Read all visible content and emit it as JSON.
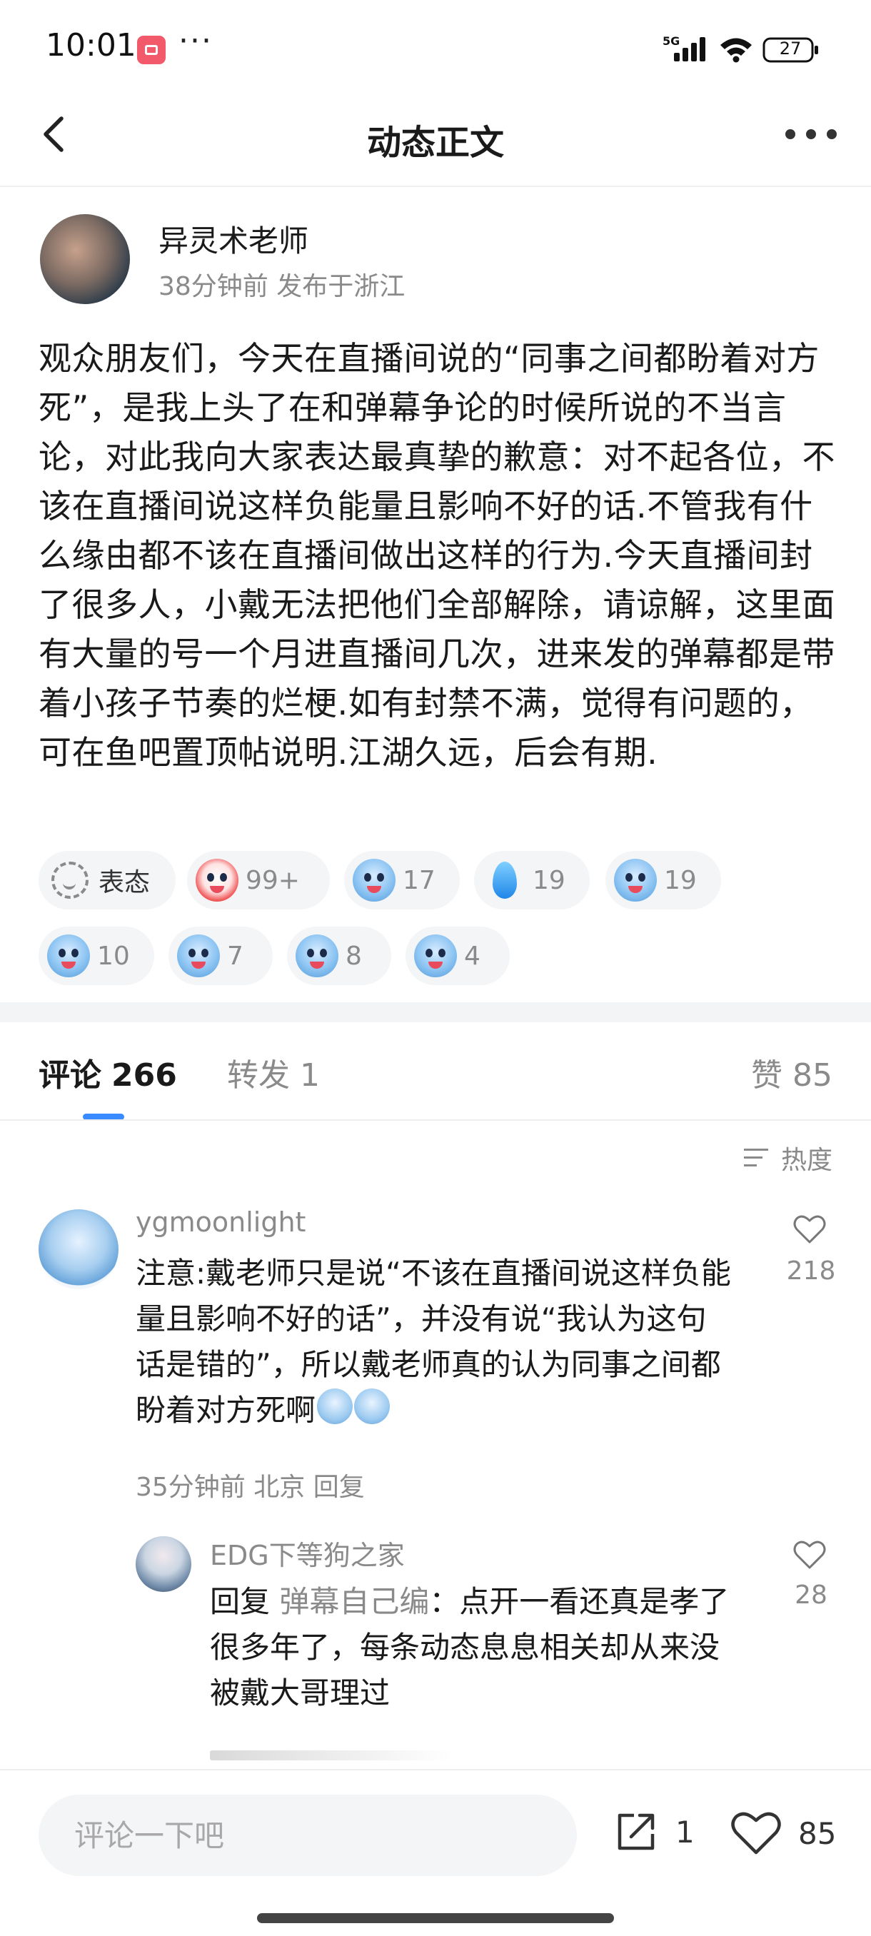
{
  "status_bar": {
    "time": "10:01",
    "more": "···",
    "network": "5G",
    "battery": "27"
  },
  "header": {
    "title": "动态正文"
  },
  "post": {
    "author": "异灵术老师",
    "meta": "38分钟前 发布于浙江",
    "body": "观众朋友们，今天在直播间说的“同事之间都盼着对方死”，是我上头了在和弹幕争论的时候所说的不当言论，对此我向大家表达最真挚的歉意：对不起各位，不该在直播间说这样负能量且影响不好的话.不管我有什么缘由都不该在直播间做出这样的行为.今天直播间封了很多人，小戴无法把他们全部解除，请谅解，这里面有大量的号一个月进直播间几次，进来发的弹幕都是带着小孩子节奏的烂梗.如有封禁不满，觉得有问题的，可在鱼吧置顶帖说明.江湖久远，后会有期."
  },
  "reactions": {
    "react_label": "表态",
    "items": [
      {
        "icon": "clown-emoji-icon",
        "count": "99+"
      },
      {
        "icon": "shark-surprised-emoji-icon",
        "count": "17"
      },
      {
        "icon": "water-drop-emoji-icon",
        "count": "19"
      },
      {
        "icon": "shark-sweat-emoji-icon",
        "count": "19"
      },
      {
        "icon": "shark-angry-emoji-icon",
        "count": "10"
      },
      {
        "icon": "shark-sign-emoji-icon",
        "count": "7"
      },
      {
        "icon": "shark-smirk-emoji-icon",
        "count": "8"
      },
      {
        "icon": "shark-starry-eyes-emoji-icon",
        "count": "4"
      }
    ]
  },
  "tabs": {
    "comments_label": "评论",
    "comments_count": "266",
    "reposts_label": "转发",
    "reposts_count": "1",
    "likes_label": "赞",
    "likes_count": "85"
  },
  "sort": {
    "label": "热度"
  },
  "comments": [
    {
      "user": "ygmoonlight",
      "text": "注意:戴老师只是说“不该在直播间说这样负能量且影响不好的话”，并没有说“我认为这句话是错的”，所以戴老师真的认为同事之间都盼着对方死啊",
      "meta": "35分钟前 北京 回复",
      "likes": "218"
    },
    {
      "user": "EDG下等狗之家",
      "reply_prefix": "回复",
      "reply_target": "弹幕自己编",
      "text": "：点开一看还真是孝了很多年了，每条动态息息相关却从来没被戴大哥理过",
      "likes": "28"
    }
  ],
  "bottom_bar": {
    "input_placeholder": "评论一下吧",
    "share_count": "1",
    "like_count": "85"
  },
  "colors": {
    "accent": "#3a8bff",
    "muted_text": "#8a8a8a",
    "chip_bg": "#f4f5f7"
  }
}
